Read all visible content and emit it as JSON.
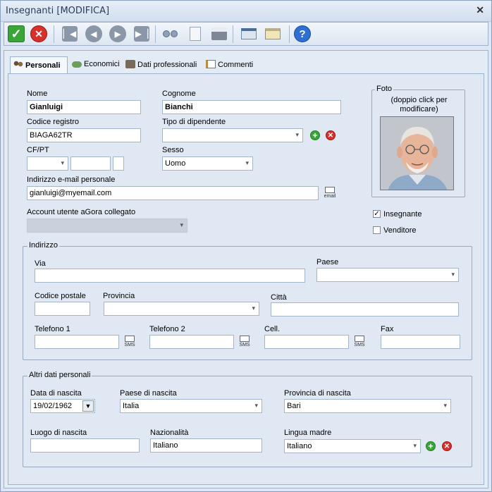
{
  "window": {
    "title": "Insegnanti [MODIFICA]",
    "close": "✕"
  },
  "toolbar": {
    "icons": [
      "confirm-icon",
      "cancel-icon",
      "first-record-icon",
      "previous-record-icon",
      "next-record-icon",
      "last-record-icon",
      "search-binoculars-icon",
      "copy-document-icon",
      "print-icon",
      "export-icon",
      "card-icon",
      "help-icon"
    ],
    "help": "?"
  },
  "tabs": [
    {
      "label": "Personali",
      "active": true
    },
    {
      "label": "Economici",
      "active": false
    },
    {
      "label": "Dati professionali",
      "active": false
    },
    {
      "label": "Commenti",
      "active": false
    }
  ],
  "personal": {
    "nome_label": "Nome",
    "nome_value": "Gianluigi",
    "cognome_label": "Cognome",
    "cognome_value": "Bianchi",
    "codice_registro_label": "Codice registro",
    "codice_registro_value": "BIAGA62TR",
    "tipo_dipendente_label": "Tipo di dipendente",
    "tipo_dipendente_value": "",
    "cfpt_label": "CF/PT",
    "sesso_label": "Sesso",
    "sesso_value": "Uomo",
    "email_label": "Indirizzo e-mail personale",
    "email_value": "gianluigi@myemail.com",
    "email_icon_text": "email",
    "account_label": "Account utente aGora collegato",
    "account_value": ""
  },
  "photo": {
    "title": "Foto",
    "hint": "(doppio click per modificare)"
  },
  "roles": {
    "insegnante_label": "Insegnante",
    "insegnante_checked": "✓",
    "venditore_label": "Venditore"
  },
  "address": {
    "group_title": "Indirizzo",
    "via_label": "Via",
    "paese_label": "Paese",
    "cap_label": "Codice postale",
    "provincia_label": "Provincia",
    "citta_label": "Città",
    "tel1_label": "Telefono 1",
    "tel2_label": "Telefono 2",
    "cell_label": "Cell.",
    "fax_label": "Fax",
    "sms_text": "SMS"
  },
  "other": {
    "group_title": "Altri dati personali",
    "data_nascita_label": "Data di nascita",
    "data_nascita_value": "19/02/1962",
    "paese_nascita_label": "Paese di nascita",
    "paese_nascita_value": "Italia",
    "provincia_nascita_label": "Provincia di nascita",
    "provincia_nascita_value": "Bari",
    "luogo_nascita_label": "Luogo di nascita",
    "luogo_nascita_value": "",
    "nazionalita_label": "Nazionalità",
    "nazionalita_value": "Italiano",
    "lingua_madre_label": "Lingua madre",
    "lingua_madre_value": "Italiano"
  },
  "colors": {
    "confirm": "#3aa63a",
    "cancel": "#d8302a",
    "help": "#2f6fd0",
    "nav": "#8a97a8"
  }
}
